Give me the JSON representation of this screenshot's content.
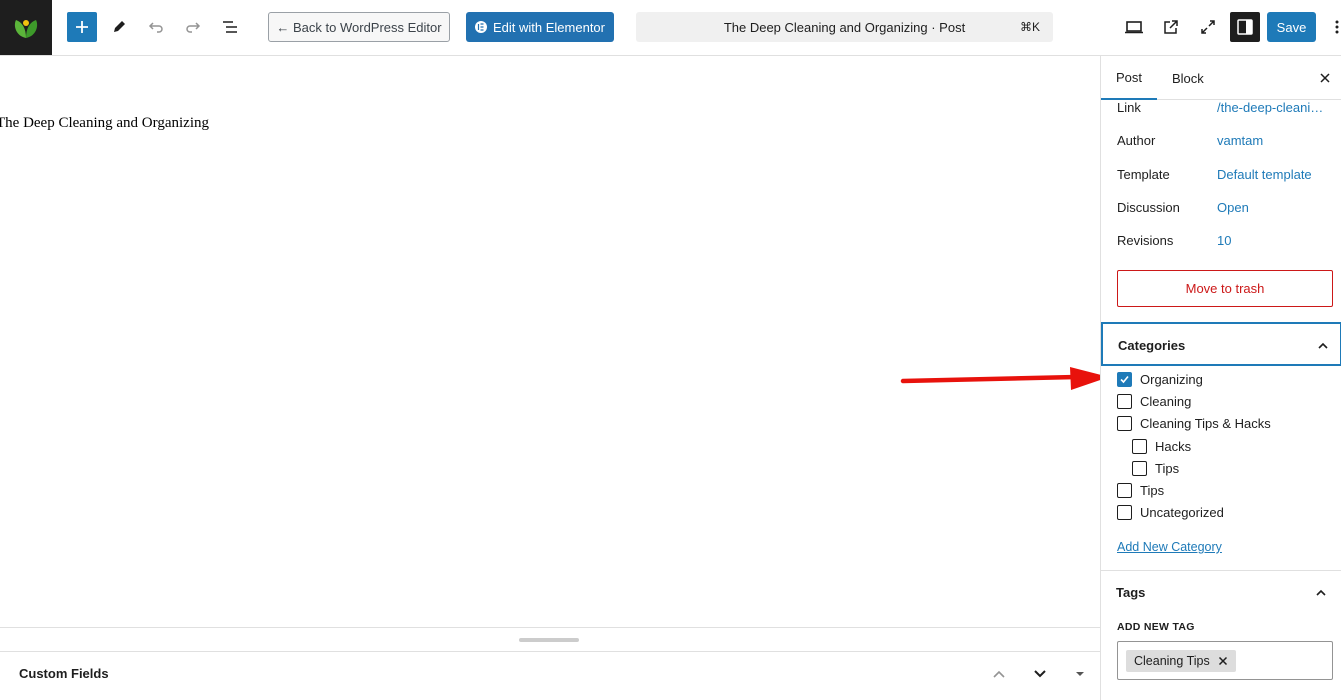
{
  "toolbar": {
    "back_label": "← Back to WordPress Editor",
    "elementor_label": "Edit with Elementor",
    "doc_title": "The Deep Cleaning and Organizing · Post",
    "shortcut": "⌘K",
    "save_label": "Save"
  },
  "canvas": {
    "post_title": "The Deep Cleaning and Organizing"
  },
  "metaboxes": {
    "custom_fields_title": "Custom Fields"
  },
  "sidebar": {
    "tabs": [
      {
        "label": "Post"
      },
      {
        "label": "Block"
      }
    ],
    "rows": [
      {
        "label": "Link",
        "value": "/the-deep-cleaning-and-organizing/"
      },
      {
        "label": "Author",
        "value": "vamtam"
      },
      {
        "label": "Template",
        "value": "Default template"
      },
      {
        "label": "Discussion",
        "value": "Open"
      },
      {
        "label": "Revisions",
        "value": "10"
      }
    ],
    "trash_label": "Move to trash",
    "categories": {
      "title": "Categories",
      "items": [
        {
          "label": "Organizing",
          "checked": true
        },
        {
          "label": "Cleaning",
          "checked": false
        },
        {
          "label": "Cleaning Tips & Hacks",
          "checked": false
        },
        {
          "label": "Hacks",
          "checked": false
        },
        {
          "label": "Tips",
          "checked": false
        },
        {
          "label": "Tips",
          "checked": false
        },
        {
          "label": "Uncategorized",
          "checked": false
        }
      ],
      "add_label": "Add New Category"
    },
    "tags": {
      "title": "Tags",
      "add_new_label": "ADD NEW TAG",
      "chips": [
        {
          "label": "Cleaning Tips"
        }
      ]
    }
  },
  "colors": {
    "accent": "#1e7ab8",
    "danger": "#cc1818",
    "annotation_arrow": "#e8120c"
  }
}
